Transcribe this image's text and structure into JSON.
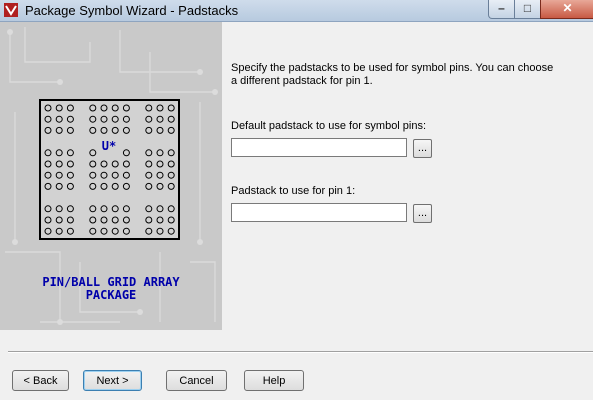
{
  "window": {
    "title": "Package Symbol Wizard - Padstacks",
    "controls": [
      "minimize",
      "maximize",
      "close"
    ]
  },
  "illustration": {
    "chip_label": "U*",
    "caption_line1": "PIN/BALL GRID ARRAY",
    "caption_line2": "PACKAGE"
  },
  "main": {
    "instructions": "Specify the padstacks to be used for symbol pins. You can choose a different padstack for pin 1.",
    "default_padstack": {
      "label": "Default padstack to use for symbol pins:",
      "value": "",
      "browse_label": "..."
    },
    "pin1_padstack": {
      "label": "Padstack to use for pin 1:",
      "value": "",
      "browse_label": "..."
    }
  },
  "footer": {
    "back_label": "< Back",
    "next_label": "Next >",
    "cancel_label": "Cancel",
    "help_label": "Help"
  },
  "colors": {
    "caption_blue": "#0000aa",
    "panel_gray": "#c9c9c9",
    "dialog_bg": "#f0f0f0"
  },
  "icons": {
    "app": "cadence-app-icon",
    "minimize": "minimize-icon",
    "maximize": "maximize-icon",
    "close": "close-icon"
  }
}
